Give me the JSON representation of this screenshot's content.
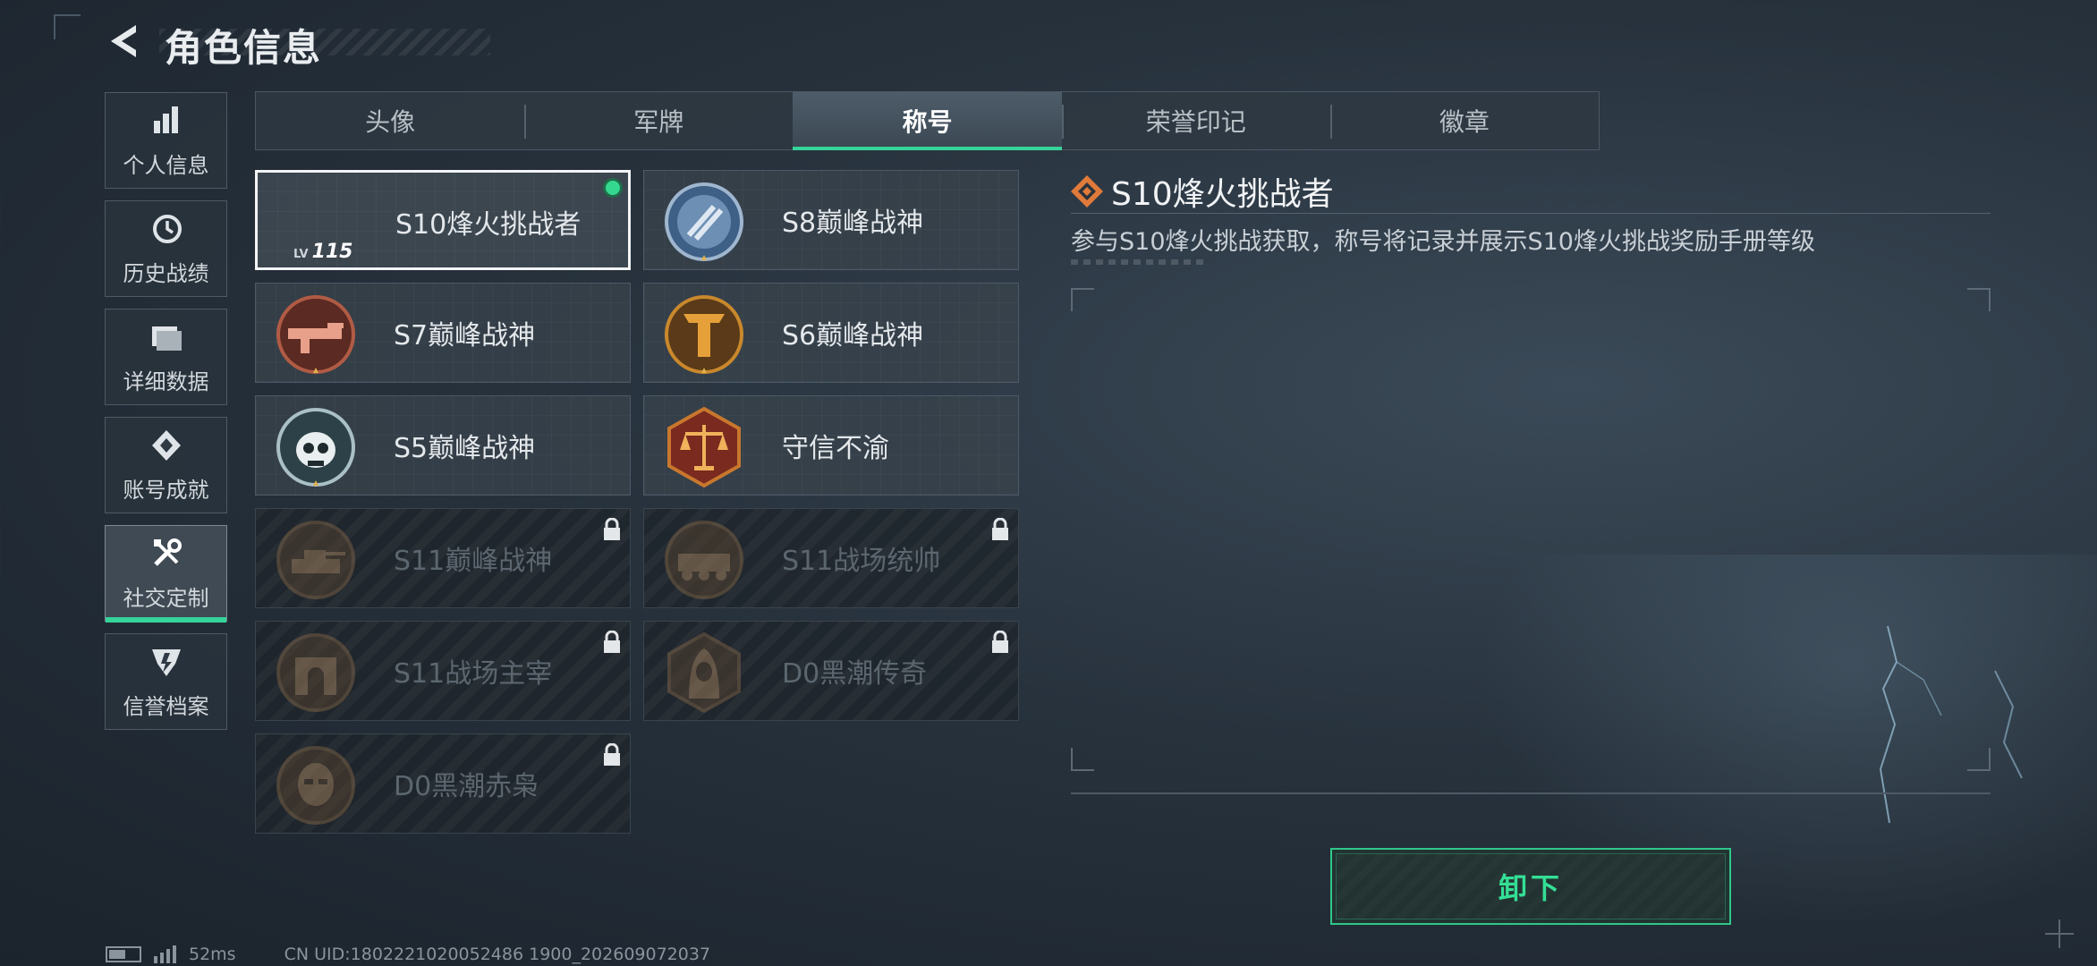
{
  "header": {
    "title": "角色信息"
  },
  "sidebar": {
    "items": [
      {
        "label": "个人信息",
        "icon": "bar-chart-icon",
        "active": false
      },
      {
        "label": "历史战绩",
        "icon": "history-icon",
        "active": false
      },
      {
        "label": "详细数据",
        "icon": "folder-icon",
        "active": false
      },
      {
        "label": "账号成就",
        "icon": "achievement-icon",
        "active": false
      },
      {
        "label": "社交定制",
        "icon": "tools-icon",
        "active": true
      },
      {
        "label": "信誉档案",
        "icon": "reputation-icon",
        "active": false
      }
    ]
  },
  "tabs": [
    {
      "label": "头像",
      "active": false
    },
    {
      "label": "军牌",
      "active": false
    },
    {
      "label": "称号",
      "active": true
    },
    {
      "label": "荣誉印记",
      "active": false
    },
    {
      "label": "徽章",
      "active": false
    }
  ],
  "titles": [
    {
      "label": "S10烽火挑战者",
      "locked": false,
      "equipped": true,
      "lv_prefix": "LV",
      "level": "115"
    },
    {
      "label": "S8巅峰战神",
      "locked": false,
      "badge": "blue-shield-badge"
    },
    {
      "label": "S7巅峰战神",
      "locked": false,
      "badge": "rifle-badge"
    },
    {
      "label": "S6巅峰战神",
      "locked": false,
      "badge": "gold-t-badge"
    },
    {
      "label": "S5巅峰战神",
      "locked": false,
      "badge": "skull-badge"
    },
    {
      "label": "守信不渝",
      "locked": false,
      "badge": "scales-badge"
    },
    {
      "label": "S11巅峰战神",
      "locked": true,
      "badge": "tank-badge"
    },
    {
      "label": "S11战场统帅",
      "locked": true,
      "badge": "vehicle-badge"
    },
    {
      "label": "S11战场主宰",
      "locked": true,
      "badge": "arch-badge"
    },
    {
      "label": "D0黑潮传奇",
      "locked": true,
      "badge": "hooded-badge"
    },
    {
      "label": "D0黑潮赤枭",
      "locked": true,
      "badge": "mask-badge"
    }
  ],
  "detail": {
    "title": "S10烽火挑战者",
    "description": "参与S10烽火挑战获取，称号将记录并展示S10烽火挑战奖励手册等级"
  },
  "action": {
    "unequip_label": "卸下"
  },
  "status_bar": {
    "ping": "52ms",
    "uid": "CN UID:1802221020052486 1900_202609072037"
  },
  "colors": {
    "accent": "#35d49a",
    "equipped_dot": "#34d98f",
    "title_icon": "#e07a3a"
  }
}
